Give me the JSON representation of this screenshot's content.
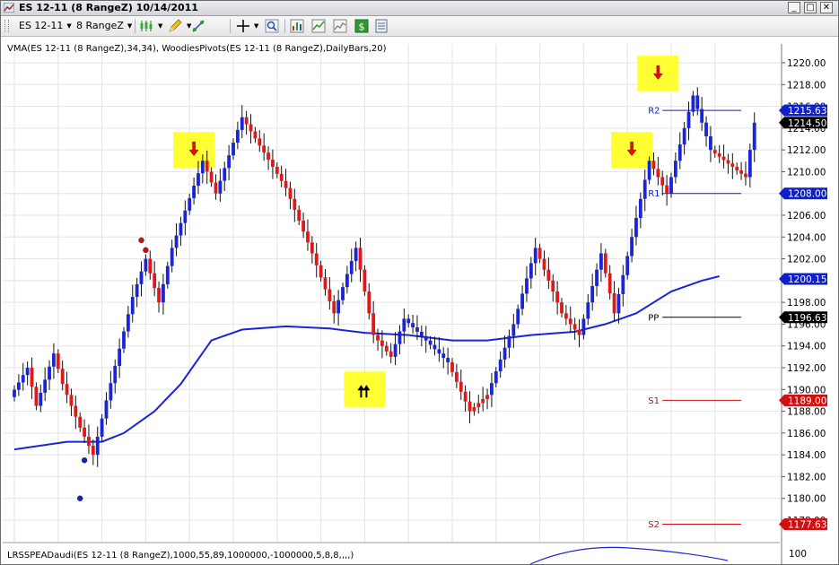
{
  "window": {
    "title": "ES 12-11 (8 RangeZ)  10/14/2011",
    "minimize_glyph": "_",
    "maximize_glyph": "□",
    "close_glyph": "✕"
  },
  "toolbar": {
    "instrument": "ES 12-11",
    "interval": "8 RangeZ",
    "icons": [
      "bar-style-icon",
      "drawing-pencil-icon",
      "draw-tools-icon",
      "crosshair-icon",
      "zoom-icon",
      "indicators-icon",
      "strategies-icon",
      "chart-properties-icon",
      "order-entry-icon",
      "data-box-icon"
    ]
  },
  "indicator_label": "VMA(ES 12-11 (8 RangeZ),34,34), WoodiesPivots(ES 12-11 (8 RangeZ),DailyBars,20)",
  "lower_panel_label": "LRSSPEADaudi(ES 12-11 (8 RangeZ),1000,55,89,1000000,-1000000,5,8,8,,,,)",
  "chart_data": {
    "type": "candlestick",
    "yaxis_ticks": [
      "1220.00",
      "1218.00",
      "1216.00",
      "1214.00",
      "1212.00",
      "1210.00",
      "1208.00",
      "1206.00",
      "1204.00",
      "1202.00",
      "1200.00",
      "1198.00",
      "1196.00",
      "1194.00",
      "1192.00",
      "1190.00",
      "1188.00",
      "1186.00",
      "1184.00",
      "1182.00",
      "1180.00",
      "1178.00"
    ],
    "ylim": [
      1177,
      1221
    ],
    "grid": true,
    "price_badges": [
      {
        "label": "1215.63",
        "value": 1215.63,
        "color": "#1020c8"
      },
      {
        "label": "1214.50",
        "value": 1214.5,
        "color": "#000000"
      },
      {
        "label": "1208.00",
        "value": 1208.0,
        "color": "#1020c8"
      },
      {
        "label": "1200.15",
        "value": 1200.15,
        "color": "#1020c8"
      },
      {
        "label": "1196.63",
        "value": 1196.63,
        "color": "#000000"
      },
      {
        "label": "1189.00",
        "value": 1189.0,
        "color": "#d01010"
      },
      {
        "label": "1177.63",
        "value": 1177.63,
        "color": "#d01010"
      }
    ],
    "pivots": [
      {
        "label": "R2",
        "value": 1215.63,
        "color": "#1020c8"
      },
      {
        "label": "R1",
        "value": 1208.0,
        "color": "#1020c8"
      },
      {
        "label": "PP",
        "value": 1196.63,
        "color": "#000000"
      },
      {
        "label": "S1",
        "value": 1189.0,
        "color": "#d01010"
      },
      {
        "label": "S2",
        "value": 1177.63,
        "color": "#d01010"
      }
    ],
    "lower_panel_tick": "100",
    "segments": [
      {
        "start": 1189.3,
        "end": 1192,
        "count": 4,
        "color": "blue"
      },
      {
        "start": 1192,
        "end": 1188.5,
        "count": 2,
        "color": "red"
      },
      {
        "start": 1188.5,
        "end": 1193.3,
        "count": 4,
        "color": "blue"
      },
      {
        "start": 1193.3,
        "end": 1190.5,
        "count": 2,
        "color": "red"
      },
      {
        "start": 1190.5,
        "end": 1186.5,
        "count": 4,
        "color": "red"
      },
      {
        "start": 1186.5,
        "end": 1184,
        "count": 3,
        "color": "red"
      },
      {
        "start": 1184,
        "end": 1189,
        "count": 3,
        "color": "blue"
      },
      {
        "start": 1189,
        "end": 1198.5,
        "count": 6,
        "color": "blue"
      },
      {
        "start": 1198.5,
        "end": 1202,
        "count": 3,
        "color": "blue"
      },
      {
        "start": 1202,
        "end": 1198,
        "count": 3,
        "color": "red"
      },
      {
        "start": 1198,
        "end": 1203,
        "count": 3,
        "color": "blue"
      },
      {
        "start": 1203,
        "end": 1211,
        "count": 7,
        "color": "blue"
      },
      {
        "start": 1211,
        "end": 1208,
        "count": 3,
        "color": "red"
      },
      {
        "start": 1208,
        "end": 1215,
        "count": 6,
        "color": "blue"
      },
      {
        "start": 1215,
        "end": 1208.5,
        "count": 10,
        "color": "red"
      },
      {
        "start": 1208.5,
        "end": 1202.5,
        "count": 6,
        "color": "red"
      },
      {
        "start": 1202.5,
        "end": 1197,
        "count": 5,
        "color": "red"
      },
      {
        "start": 1197,
        "end": 1203,
        "count": 5,
        "color": "blue"
      },
      {
        "start": 1203,
        "end": 1195,
        "count": 4,
        "color": "red"
      },
      {
        "start": 1195,
        "end": 1193,
        "count": 4,
        "color": "red"
      },
      {
        "start": 1193,
        "end": 1196.5,
        "count": 3,
        "color": "blue"
      },
      {
        "start": 1196.5,
        "end": 1192.5,
        "count": 10,
        "color": "blue"
      },
      {
        "start": 1192.5,
        "end": 1188,
        "count": 5,
        "color": "red"
      },
      {
        "start": 1188,
        "end": 1189.5,
        "count": 4,
        "color": "red"
      },
      {
        "start": 1189.5,
        "end": 1196,
        "count": 6,
        "color": "blue"
      },
      {
        "start": 1196,
        "end": 1203,
        "count": 5,
        "color": "blue"
      },
      {
        "start": 1203,
        "end": 1197,
        "count": 6,
        "color": "red"
      },
      {
        "start": 1197,
        "end": 1195,
        "count": 4,
        "color": "red"
      },
      {
        "start": 1195,
        "end": 1202.5,
        "count": 5,
        "color": "blue"
      },
      {
        "start": 1202.5,
        "end": 1197,
        "count": 3,
        "color": "red"
      },
      {
        "start": 1197,
        "end": 1211,
        "count": 8,
        "color": "blue"
      },
      {
        "start": 1211,
        "end": 1208,
        "count": 4,
        "color": "red"
      },
      {
        "start": 1208,
        "end": 1217,
        "count": 6,
        "color": "blue"
      },
      {
        "start": 1217,
        "end": 1212,
        "count": 4,
        "color": "blue"
      },
      {
        "start": 1212,
        "end": 1209.5,
        "count": 8,
        "color": "red"
      },
      {
        "start": 1209.5,
        "end": 1214.5,
        "count": 2,
        "color": "blue"
      }
    ],
    "vma": [
      {
        "bar": 0,
        "value": 1184.5
      },
      {
        "bar": 12,
        "value": 1185.2
      },
      {
        "bar": 20,
        "value": 1185.2
      },
      {
        "bar": 25,
        "value": 1186
      },
      {
        "bar": 32,
        "value": 1188
      },
      {
        "bar": 38,
        "value": 1190.5
      },
      {
        "bar": 45,
        "value": 1194.5
      },
      {
        "bar": 52,
        "value": 1195.5
      },
      {
        "bar": 62,
        "value": 1195.8
      },
      {
        "bar": 72,
        "value": 1195.6
      },
      {
        "bar": 80,
        "value": 1195.2
      },
      {
        "bar": 90,
        "value": 1195
      },
      {
        "bar": 100,
        "value": 1194.5
      },
      {
        "bar": 108,
        "value": 1194.5
      },
      {
        "bar": 118,
        "value": 1195
      },
      {
        "bar": 128,
        "value": 1195.3
      },
      {
        "bar": 135,
        "value": 1196
      },
      {
        "bar": 142,
        "value": 1197
      },
      {
        "bar": 150,
        "value": 1199
      },
      {
        "bar": 157,
        "value": 1200
      },
      {
        "bar": 161,
        "value": 1200.4
      }
    ],
    "dots": [
      {
        "bar": 29,
        "value": 1203.7,
        "color": "#d01010"
      },
      {
        "bar": 30,
        "value": 1202.8,
        "color": "#d01010"
      },
      {
        "bar": 16,
        "value": 1183.5,
        "color": "#1020c8"
      },
      {
        "bar": 15,
        "value": 1180,
        "color": "#1020c8"
      }
    ],
    "signals": [
      {
        "bar": 41,
        "value": 1212,
        "dir": "down"
      },
      {
        "bar": 141,
        "value": 1212,
        "dir": "down"
      },
      {
        "bar": 147,
        "value": 1219,
        "dir": "down"
      },
      {
        "bar": 80,
        "value": 1190,
        "dir": "up"
      }
    ]
  },
  "colors": {
    "bull": "#1a24d8",
    "bear": "#e01818",
    "vma": "#1a24d8",
    "grid": "#e3e3e3",
    "highlight": "#ffff33",
    "signal_down": "#e01010",
    "signal_up": "#000000"
  }
}
